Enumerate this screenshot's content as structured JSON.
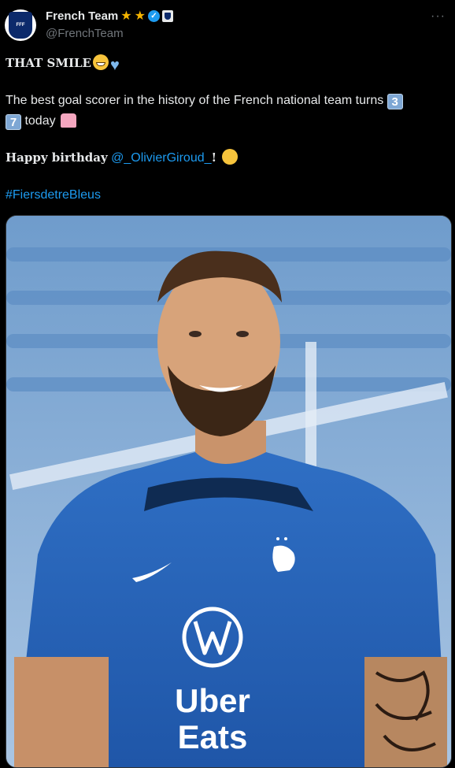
{
  "account": {
    "name": "French Team",
    "handle": "@FrenchTeam",
    "avatar_icon": "fff-crest-icon",
    "badges": [
      "star-icon",
      "star-icon",
      "verified-badge-icon",
      "affiliate-badge-icon"
    ],
    "more_label": "···"
  },
  "tweet": {
    "line1_text": "THAT SMILE",
    "line2_text_a": "The best goal scorer in the history of the French national team turns",
    "line2_key_a": "3",
    "line2_key_b": "7",
    "line2_text_b": "today",
    "line3_text": "Happy birthday",
    "mention": "@_OlivierGiroud_",
    "line3_punct": "!",
    "hashtag": "#FiersdetreBleus"
  },
  "media": {
    "jersey_text_1": "Uber",
    "jersey_text_2": "Eats"
  },
  "colors": {
    "background": "#000000",
    "text": "#e7e9ea",
    "secondary": "#71767b",
    "link": "#1d9bf0",
    "star": "#f5b400",
    "jersey": "#2a63b8"
  }
}
